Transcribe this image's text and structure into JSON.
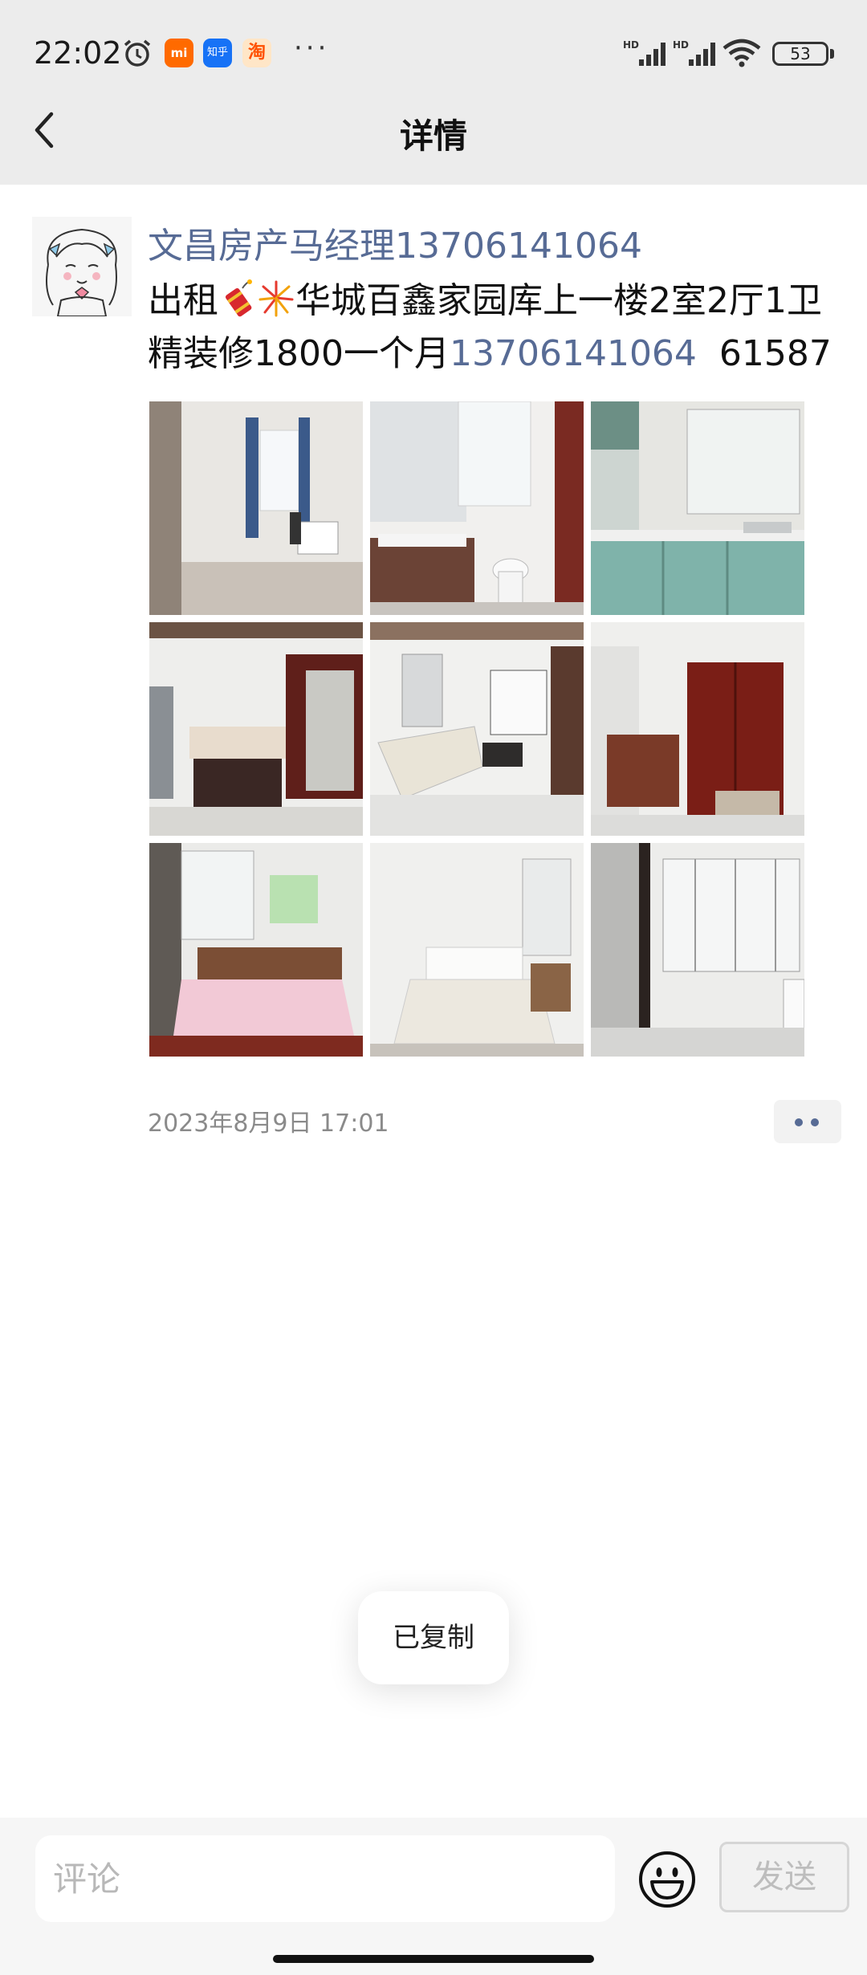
{
  "status_bar": {
    "time": "22:02",
    "battery": "53",
    "icons": [
      "alarm-icon",
      "xiaomi-app-icon",
      "zhihu-app-icon",
      "taobao-app-icon",
      "more-notifications-icon",
      "hd-signal-icon",
      "hd-signal-icon",
      "wifi-icon",
      "battery-icon"
    ],
    "app_mi": "mi",
    "app_zhihu": "知乎",
    "app_taobao": "淘",
    "more": "···",
    "hd": "HD"
  },
  "header": {
    "title": "详情",
    "back_icon": "chevron-left-icon"
  },
  "post": {
    "author": "文昌房产马经理13706141064",
    "text_part1": "出租",
    "text_part2": "华城百鑫家园库上一楼2室2厅1卫精装修1800一个月",
    "phone": "13706141064",
    "text_part3": "  61587",
    "emojis": [
      "firecracker-icon",
      "fireworks-icon"
    ],
    "photos": [
      "bedroom-window-photo",
      "bathroom-photo",
      "kitchen-photo",
      "dining-room-photo",
      "living-room-photo",
      "hallway-door-photo",
      "bedroom-pink-bed-photo",
      "bedroom-white-bed-photo",
      "balcony-washer-photo"
    ],
    "timestamp": "2023年8月9日 17:01",
    "more_icon": "two-dot-more-icon"
  },
  "toast": {
    "text": "已复制"
  },
  "comment_bar": {
    "placeholder": "评论",
    "emoji_icon": "smiley-icon",
    "send_label": "发送"
  },
  "colors": {
    "link_blue": "#576b95",
    "header_bg": "#ececec",
    "bar_bg": "#f6f6f6"
  }
}
